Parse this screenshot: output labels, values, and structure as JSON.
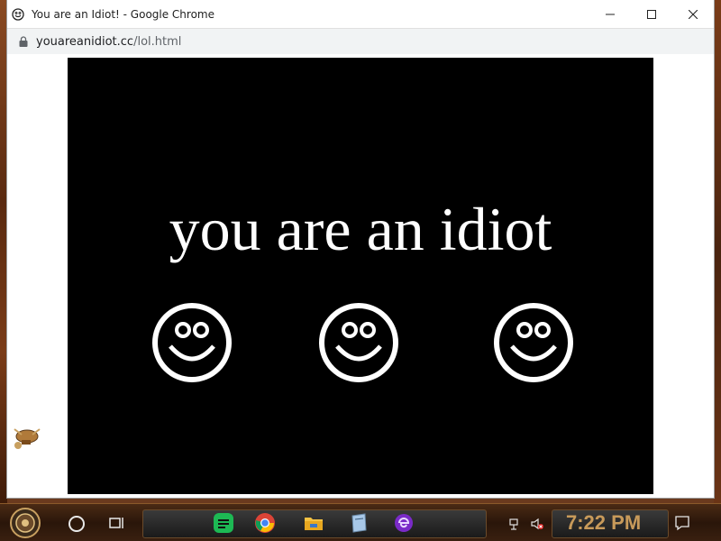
{
  "window": {
    "title": "You are an Idiot! - Google Chrome",
    "controls": [
      "minimize",
      "maximize",
      "close"
    ]
  },
  "address": {
    "domain": "youareanidiot.cc",
    "path": "/lol.html"
  },
  "page": {
    "headline": "you are an idiot",
    "background": "#000000",
    "text_color": "#ffffff",
    "smiley_count": 3
  },
  "taskbar": {
    "clock": "7:22 PM",
    "pinned_apps": [
      "spotify-icon",
      "chrome-icon",
      "file-explorer-icon",
      "notes-icon",
      "browser-icon"
    ]
  }
}
